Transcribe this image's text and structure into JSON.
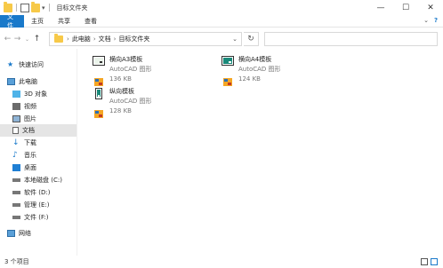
{
  "window": {
    "title": "目标文件夹",
    "controls": [
      "—",
      "☐",
      "✕"
    ]
  },
  "ribbon": {
    "tabs": [
      "文件",
      "主页",
      "共享",
      "查看"
    ]
  },
  "address": {
    "crumbs": [
      "此电脑",
      "文档",
      "目标文件夹"
    ]
  },
  "sidebar": {
    "items": [
      {
        "label": "快速访问",
        "icon": "star-icon"
      },
      {
        "label": "此电脑",
        "icon": "computer-icon"
      },
      {
        "label": "3D 对象",
        "icon": "cube-icon"
      },
      {
        "label": "视频",
        "icon": "video-icon"
      },
      {
        "label": "图片",
        "icon": "picture-icon"
      },
      {
        "label": "文档",
        "icon": "document-icon",
        "selected": true
      },
      {
        "label": "下载",
        "icon": "download-icon"
      },
      {
        "label": "音乐",
        "icon": "music-icon"
      },
      {
        "label": "桌面",
        "icon": "desktop-icon"
      },
      {
        "label": "本地磁盘 (C:)",
        "icon": "drive-icon"
      },
      {
        "label": "软件 (D:)",
        "icon": "drive-icon"
      },
      {
        "label": "管理 (E:)",
        "icon": "drive-icon"
      },
      {
        "label": "文件 (F:)",
        "icon": "drive-icon"
      },
      {
        "label": "网络",
        "icon": "network-icon"
      }
    ]
  },
  "files": [
    {
      "name": "横向A3模板",
      "type": "AutoCAD 图形",
      "size": "136 KB",
      "orientation": "landscape"
    },
    {
      "name": "横向A4模板",
      "type": "AutoCAD 图形",
      "size": "124 KB",
      "orientation": "landscape"
    },
    {
      "name": "纵向模板",
      "type": "AutoCAD 图形",
      "size": "128 KB",
      "orientation": "portrait"
    }
  ],
  "status": {
    "count": "3 个项目"
  },
  "colors": {
    "accent": "#1979ca",
    "selected_bg": "#e5e5e5",
    "folder": "#f7c948"
  }
}
